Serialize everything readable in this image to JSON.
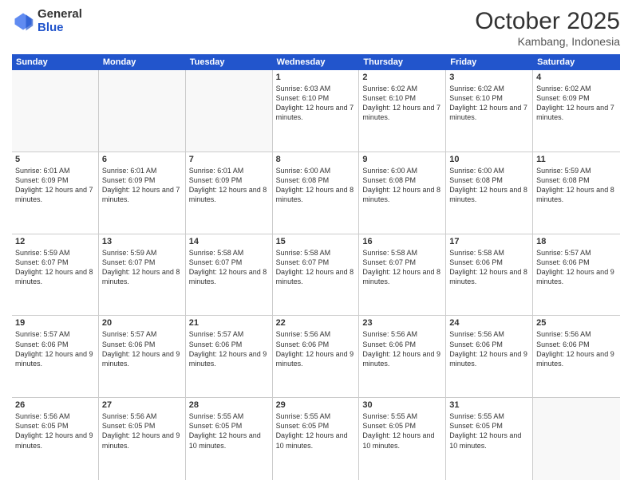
{
  "logo": {
    "general": "General",
    "blue": "Blue"
  },
  "header": {
    "month": "October 2025",
    "location": "Kambang, Indonesia"
  },
  "weekdays": [
    "Sunday",
    "Monday",
    "Tuesday",
    "Wednesday",
    "Thursday",
    "Friday",
    "Saturday"
  ],
  "weeks": [
    [
      {
        "day": "",
        "info": ""
      },
      {
        "day": "",
        "info": ""
      },
      {
        "day": "",
        "info": ""
      },
      {
        "day": "1",
        "info": "Sunrise: 6:03 AM\nSunset: 6:10 PM\nDaylight: 12 hours and 7 minutes."
      },
      {
        "day": "2",
        "info": "Sunrise: 6:02 AM\nSunset: 6:10 PM\nDaylight: 12 hours and 7 minutes."
      },
      {
        "day": "3",
        "info": "Sunrise: 6:02 AM\nSunset: 6:10 PM\nDaylight: 12 hours and 7 minutes."
      },
      {
        "day": "4",
        "info": "Sunrise: 6:02 AM\nSunset: 6:09 PM\nDaylight: 12 hours and 7 minutes."
      }
    ],
    [
      {
        "day": "5",
        "info": "Sunrise: 6:01 AM\nSunset: 6:09 PM\nDaylight: 12 hours and 7 minutes."
      },
      {
        "day": "6",
        "info": "Sunrise: 6:01 AM\nSunset: 6:09 PM\nDaylight: 12 hours and 7 minutes."
      },
      {
        "day": "7",
        "info": "Sunrise: 6:01 AM\nSunset: 6:09 PM\nDaylight: 12 hours and 8 minutes."
      },
      {
        "day": "8",
        "info": "Sunrise: 6:00 AM\nSunset: 6:08 PM\nDaylight: 12 hours and 8 minutes."
      },
      {
        "day": "9",
        "info": "Sunrise: 6:00 AM\nSunset: 6:08 PM\nDaylight: 12 hours and 8 minutes."
      },
      {
        "day": "10",
        "info": "Sunrise: 6:00 AM\nSunset: 6:08 PM\nDaylight: 12 hours and 8 minutes."
      },
      {
        "day": "11",
        "info": "Sunrise: 5:59 AM\nSunset: 6:08 PM\nDaylight: 12 hours and 8 minutes."
      }
    ],
    [
      {
        "day": "12",
        "info": "Sunrise: 5:59 AM\nSunset: 6:07 PM\nDaylight: 12 hours and 8 minutes."
      },
      {
        "day": "13",
        "info": "Sunrise: 5:59 AM\nSunset: 6:07 PM\nDaylight: 12 hours and 8 minutes."
      },
      {
        "day": "14",
        "info": "Sunrise: 5:58 AM\nSunset: 6:07 PM\nDaylight: 12 hours and 8 minutes."
      },
      {
        "day": "15",
        "info": "Sunrise: 5:58 AM\nSunset: 6:07 PM\nDaylight: 12 hours and 8 minutes."
      },
      {
        "day": "16",
        "info": "Sunrise: 5:58 AM\nSunset: 6:07 PM\nDaylight: 12 hours and 8 minutes."
      },
      {
        "day": "17",
        "info": "Sunrise: 5:58 AM\nSunset: 6:06 PM\nDaylight: 12 hours and 8 minutes."
      },
      {
        "day": "18",
        "info": "Sunrise: 5:57 AM\nSunset: 6:06 PM\nDaylight: 12 hours and 9 minutes."
      }
    ],
    [
      {
        "day": "19",
        "info": "Sunrise: 5:57 AM\nSunset: 6:06 PM\nDaylight: 12 hours and 9 minutes."
      },
      {
        "day": "20",
        "info": "Sunrise: 5:57 AM\nSunset: 6:06 PM\nDaylight: 12 hours and 9 minutes."
      },
      {
        "day": "21",
        "info": "Sunrise: 5:57 AM\nSunset: 6:06 PM\nDaylight: 12 hours and 9 minutes."
      },
      {
        "day": "22",
        "info": "Sunrise: 5:56 AM\nSunset: 6:06 PM\nDaylight: 12 hours and 9 minutes."
      },
      {
        "day": "23",
        "info": "Sunrise: 5:56 AM\nSunset: 6:06 PM\nDaylight: 12 hours and 9 minutes."
      },
      {
        "day": "24",
        "info": "Sunrise: 5:56 AM\nSunset: 6:06 PM\nDaylight: 12 hours and 9 minutes."
      },
      {
        "day": "25",
        "info": "Sunrise: 5:56 AM\nSunset: 6:06 PM\nDaylight: 12 hours and 9 minutes."
      }
    ],
    [
      {
        "day": "26",
        "info": "Sunrise: 5:56 AM\nSunset: 6:05 PM\nDaylight: 12 hours and 9 minutes."
      },
      {
        "day": "27",
        "info": "Sunrise: 5:56 AM\nSunset: 6:05 PM\nDaylight: 12 hours and 9 minutes."
      },
      {
        "day": "28",
        "info": "Sunrise: 5:55 AM\nSunset: 6:05 PM\nDaylight: 12 hours and 10 minutes."
      },
      {
        "day": "29",
        "info": "Sunrise: 5:55 AM\nSunset: 6:05 PM\nDaylight: 12 hours and 10 minutes."
      },
      {
        "day": "30",
        "info": "Sunrise: 5:55 AM\nSunset: 6:05 PM\nDaylight: 12 hours and 10 minutes."
      },
      {
        "day": "31",
        "info": "Sunrise: 5:55 AM\nSunset: 6:05 PM\nDaylight: 12 hours and 10 minutes."
      },
      {
        "day": "",
        "info": ""
      }
    ]
  ]
}
